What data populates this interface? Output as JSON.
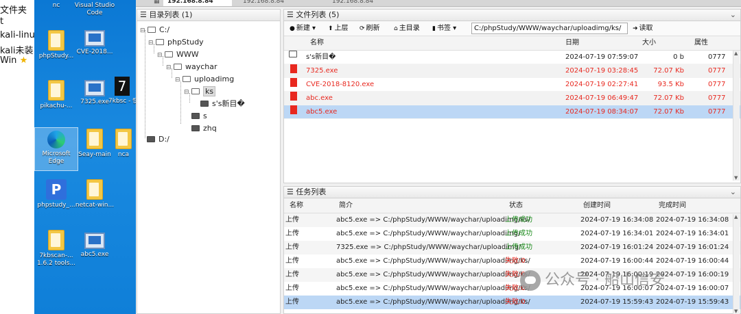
{
  "left_notes": {
    "lines": [
      "文件夹",
      "t",
      "kali-linu",
      "kali未装",
      "Win"
    ],
    "star_icon": "star-icon"
  },
  "desktop": {
    "icons": [
      {
        "label": "nc",
        "icon": "exe-icon"
      },
      {
        "label": "Visual Studio Code",
        "icon": "vscode-icon"
      },
      {
        "label": "phpStudy...",
        "icon": "folder-icon"
      },
      {
        "label": "CVE-2018...",
        "icon": "exe-icon"
      },
      {
        "label": "pikachu-...",
        "icon": "folder-icon"
      },
      {
        "label": "7325.exe",
        "icon": "exe-icon"
      },
      {
        "label": "7kbsc - 快捷",
        "icon": "app-icon"
      },
      {
        "label": "Microsoft Edge",
        "icon": "edge-icon"
      },
      {
        "label": "Seay-main",
        "icon": "folder-icon"
      },
      {
        "label": "nca",
        "icon": "folder-icon"
      },
      {
        "label": "phpstudy_...",
        "icon": "phpstudy-icon"
      },
      {
        "label": "netcat-win...",
        "icon": "folder-icon"
      },
      {
        "label": "7kbscan-... 1.6.2 tools...",
        "icon": "folder-icon"
      },
      {
        "label": "abc5.exe",
        "icon": "exe-icon"
      }
    ]
  },
  "tabs": [
    "192.168.8.84",
    "192.168.8.84",
    "192.168.8.84"
  ],
  "tree_panel": {
    "title": "目录列表 (1)",
    "nodes": [
      "C:/",
      "phpStudy",
      "WWW",
      "waychar",
      "uploadimg",
      "ks",
      "s's新目�",
      "s",
      "zhq",
      "D:/"
    ]
  },
  "file_panel": {
    "title": "文件列表 (5)",
    "toolbar": {
      "new": "新建",
      "up": "上层",
      "refresh": "刷新",
      "home": "主目录",
      "bookmark": "书签",
      "path": "C:/phpStudy/WWW/waychar/uploadimg/ks/",
      "read": "读取"
    },
    "columns": [
      "名称",
      "日期",
      "大小",
      "属性"
    ],
    "rows": [
      {
        "name": "s's新目�",
        "date": "2024-07-19 07:59:07",
        "size": "0 b",
        "attr": "0777",
        "type": "folder"
      },
      {
        "name": "7325.exe",
        "date": "2024-07-19 03:28:45",
        "size": "72.07 Kb",
        "attr": "0777",
        "type": "file"
      },
      {
        "name": "CVE-2018-8120.exe",
        "date": "2024-07-19 02:27:41",
        "size": "93.5 Kb",
        "attr": "0777",
        "type": "file"
      },
      {
        "name": "abc.exe",
        "date": "2024-07-19 06:49:47",
        "size": "72.07 Kb",
        "attr": "0777",
        "type": "file"
      },
      {
        "name": "abc5.exe",
        "date": "2024-07-19 08:34:07",
        "size": "72.07 Kb",
        "attr": "0777",
        "type": "file",
        "selected": true
      }
    ]
  },
  "task_panel": {
    "title": "任务列表",
    "columns": [
      "名称",
      "简介",
      "状态",
      "创建时间",
      "完成时间"
    ],
    "rows": [
      {
        "name": "上传",
        "desc": "abc5.exe => C:/phpStudy/WWW/waychar/uploadimg/ks/",
        "status": "上传成功",
        "ok": true,
        "created": "2024-07-19 16:34:08",
        "done": "2024-07-19 16:34:08"
      },
      {
        "name": "上传",
        "desc": "abc5.exe => C:/phpStudy/WWW/waychar/uploadimg/",
        "status": "上传成功",
        "ok": true,
        "created": "2024-07-19 16:34:01",
        "done": "2024-07-19 16:34:01"
      },
      {
        "name": "上传",
        "desc": "7325.exe => C:/phpStudy/WWW/waychar/uploadimg/",
        "status": "上传成功",
        "ok": true,
        "created": "2024-07-19 16:01:24",
        "done": "2024-07-19 16:01:24"
      },
      {
        "name": "上传",
        "desc": "abc5.exe => C:/phpStudy/WWW/waychar/uploadimg/ks/",
        "status": "失败:0",
        "ok": false,
        "created": "2024-07-19 16:00:44",
        "done": "2024-07-19 16:00:44"
      },
      {
        "name": "上传",
        "desc": "abc5.exe => C:/phpStudy/WWW/waychar/uploadimg/ks/",
        "status": "失败:0",
        "ok": false,
        "created": "2024-07-19 16:00:19",
        "done": "2024-07-19 16:00:19"
      },
      {
        "name": "上传",
        "desc": "abc5.exe => C:/phpStudy/WWW/waychar/uploadimg/ks/",
        "status": "失败:0",
        "ok": false,
        "created": "2024-07-19 16:00:07",
        "done": "2024-07-19 16:00:07"
      },
      {
        "name": "上传",
        "desc": "abc5.exe => C:/phpStudy/WWW/waychar/uploadimg/ks/",
        "status": "失败:0",
        "ok": false,
        "created": "2024-07-19 15:59:43",
        "done": "2024-07-19 15:59:43",
        "selected": true
      }
    ]
  },
  "watermark": "公众号 · 船山信安",
  "colors": {
    "error": "#e8281f",
    "success": "#1a8a1a",
    "selection": "#bcd7f5"
  }
}
